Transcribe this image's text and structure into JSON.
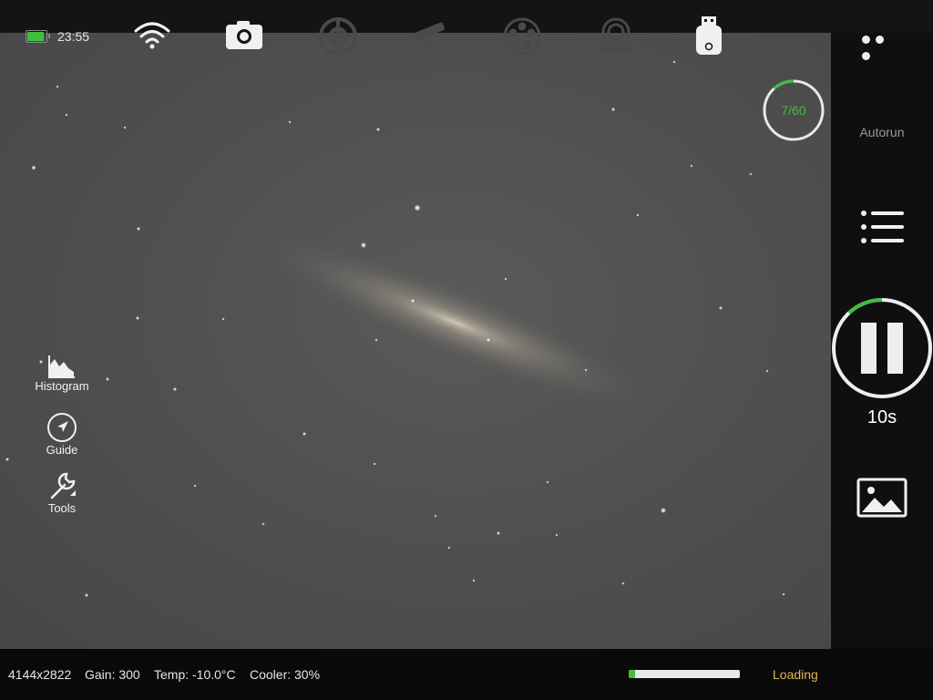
{
  "status_bar": {
    "time": "23:55",
    "battery_color": "#3fbf3f",
    "icons": [
      "wifi-icon",
      "camera-icon",
      "focuser-icon",
      "telescope-icon",
      "filter-wheel-icon",
      "mount-icon",
      "usb-drive-icon"
    ]
  },
  "right_panel": {
    "counter": {
      "text": "7/60",
      "current": 7,
      "total": 60
    },
    "autorun_label": "Autorun",
    "exposure_label": "10s",
    "pause_progress": 0.12
  },
  "left_tools": [
    {
      "label": "Histogram"
    },
    {
      "label": "Guide"
    },
    {
      "label": "Tools"
    }
  ],
  "bottom_bar": {
    "resolution": "4144x2822",
    "gain": "Gain: 300",
    "temp": "Temp: -10.0°C",
    "cooler": "Cooler: 30%",
    "download_progress": 0.06,
    "loading_label": "Loading"
  },
  "colors": {
    "accent": "#3fbf3f",
    "loading": "#e5b84c"
  }
}
